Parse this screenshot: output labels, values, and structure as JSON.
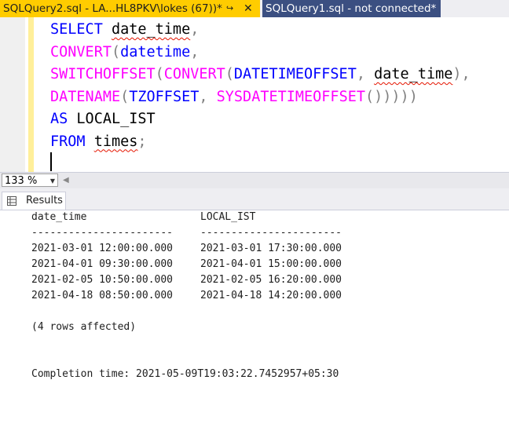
{
  "tabs": [
    {
      "label": "SQLQuery2.sql - LA...HL8PKV\\lokes (67))*",
      "active": true
    },
    {
      "label": "SQLQuery1.sql - not connected*",
      "active": false
    }
  ],
  "tab_icons": {
    "pin": "pin-icon",
    "close": "close-icon"
  },
  "editor": {
    "lines": {
      "l1_kw": "SELECT",
      "l1_col": "date_time",
      "l1_comma": ",",
      "l2_fn": "CONVERT",
      "l2_open": "(",
      "l2_type": "datetime",
      "l2_comma": ",",
      "l3_fn1": "SWITCHOFFSET",
      "l3_open1": "(",
      "l3_fn2": "CONVERT",
      "l3_open2": "(",
      "l3_type": "DATETIMEOFFSET",
      "l3_comma1": ", ",
      "l3_col": "date_time",
      "l3_comma2": "),",
      "l4_fn1": "DATENAME",
      "l4_open": "(",
      "l4_arg": "TZOFFSET",
      "l4_comma": ", ",
      "l4_fn2": "SYSDATETIMEOFFSET",
      "l4_close": "()))))",
      "l5_kw": "AS",
      "l5_alias": "LOCAL_IST",
      "l6_kw": "FROM",
      "l6_table": "times",
      "l6_semi": ";"
    }
  },
  "zoom": {
    "value": "133 %"
  },
  "results_tab": {
    "label": "Results"
  },
  "results": {
    "headers": [
      "date_time",
      "LOCAL_IST"
    ],
    "separator": "-----------------------",
    "rows": [
      [
        "2021-03-01 12:00:00.000",
        "2021-03-01 17:30:00.000"
      ],
      [
        "2021-04-01 09:30:00.000",
        "2021-04-01 15:00:00.000"
      ],
      [
        "2021-02-05 10:50:00.000",
        "2021-02-05 16:20:00.000"
      ],
      [
        "2021-04-18 08:50:00.000",
        "2021-04-18 14:20:00.000"
      ]
    ],
    "rows_affected": "(4 rows affected)",
    "completion": "Completion time: 2021-05-09T19:03:22.7452957+05:30"
  },
  "colors": {
    "active_tab": "#ffcc00",
    "inactive_tab": "#3b4f81",
    "keyword": "#0000ff",
    "function": "#ff00ff",
    "operator": "#808080"
  }
}
